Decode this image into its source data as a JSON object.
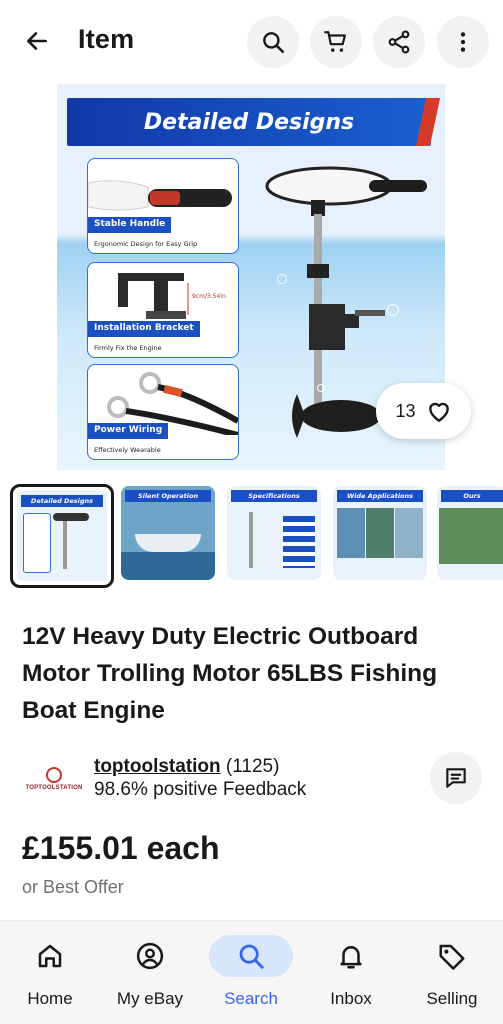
{
  "header": {
    "title": "Item",
    "back_icon": "arrow-left-icon",
    "search_icon": "search-icon",
    "cart_icon": "cart-icon",
    "share_icon": "share-icon",
    "more_icon": "more-vertical-icon"
  },
  "hero": {
    "banner_text": "Detailed Designs",
    "features": [
      {
        "title": "Stable Handle",
        "subtitle": "Ergonomic Design for Easy Grip"
      },
      {
        "title": "Installation Bracket",
        "subtitle": "Firmly Fix the Engine"
      },
      {
        "title": "Power Wiring",
        "subtitle": "Effectively Wearable"
      }
    ],
    "bracket_measure": "9cm/3.54in",
    "watch_count": "13",
    "heart_icon": "heart-icon"
  },
  "thumbnails": [
    {
      "label": "Detailed Designs",
      "selected": true
    },
    {
      "label": "Silent Operation",
      "selected": false
    },
    {
      "label": "Specifications",
      "selected": false
    },
    {
      "label": "Wide Applications",
      "selected": false
    },
    {
      "label": "Ours",
      "selected": false
    }
  ],
  "item": {
    "title": "12V Heavy Duty Electric Outboard Motor Trolling Motor 65LBS Fishing Boat Engine"
  },
  "seller": {
    "logo_text": "TOPTOOLSTATION",
    "name": "toptoolstation",
    "count": " (1125)",
    "feedback": "98.6% positive Feedback",
    "chat_icon": "message-icon"
  },
  "price": {
    "amount": "£155.01 each",
    "offer": "or Best Offer"
  },
  "nav": {
    "items": [
      {
        "label": "Home",
        "icon": "home-icon",
        "active": false
      },
      {
        "label": "My eBay",
        "icon": "user-circle-icon",
        "active": false
      },
      {
        "label": "Search",
        "icon": "search-icon",
        "active": true
      },
      {
        "label": "Inbox",
        "icon": "bell-icon",
        "active": false
      },
      {
        "label": "Selling",
        "icon": "tag-icon",
        "active": false
      }
    ]
  },
  "colors": {
    "accent": "#3665f3",
    "active_pill": "#d7e6fb",
    "banner_blue": "#1b4fc4",
    "text_primary": "#191919",
    "text_secondary": "#707070"
  }
}
